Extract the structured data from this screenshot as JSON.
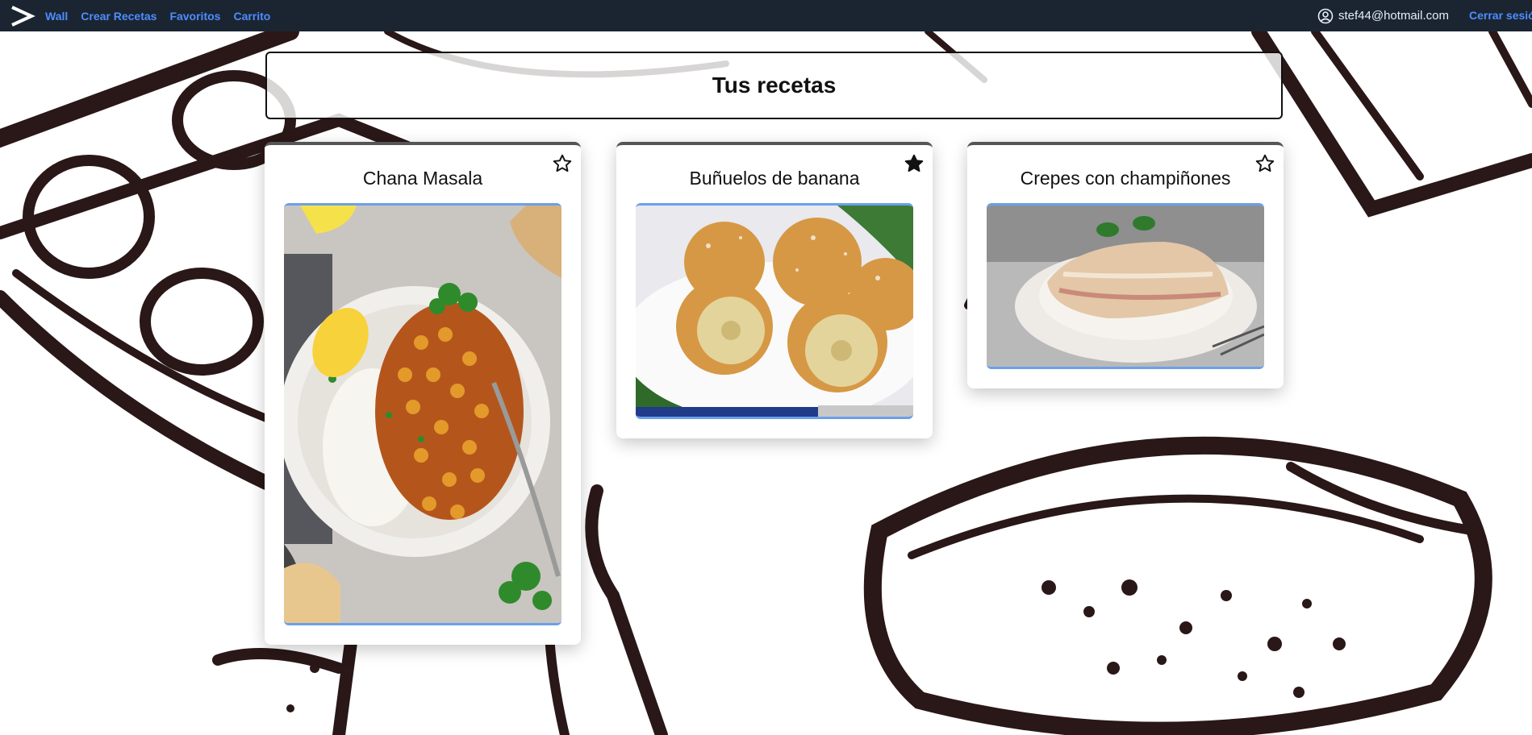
{
  "nav": {
    "links": [
      "Wall",
      "Crear Recetas",
      "Favoritos",
      "Carrito"
    ],
    "user_email": "stef44@hotmail.com",
    "logout_label": "Cerrar sesión"
  },
  "page": {
    "title": "Tus recetas"
  },
  "recipes": [
    {
      "name": "Chana Masala",
      "favorite": false
    },
    {
      "name": "Buñuelos de banana",
      "favorite": true
    },
    {
      "name": "Crepes con champiñones",
      "favorite": false
    }
  ],
  "colors": {
    "navbar_bg": "#1b2532",
    "nav_link": "#4d8dff",
    "image_border": "#6aa0ea"
  },
  "icons": {
    "logo": "chevron-right-logo-icon",
    "user": "user-circle-icon",
    "favorite_on": "star-filled-icon",
    "favorite_off": "star-outline-icon"
  }
}
